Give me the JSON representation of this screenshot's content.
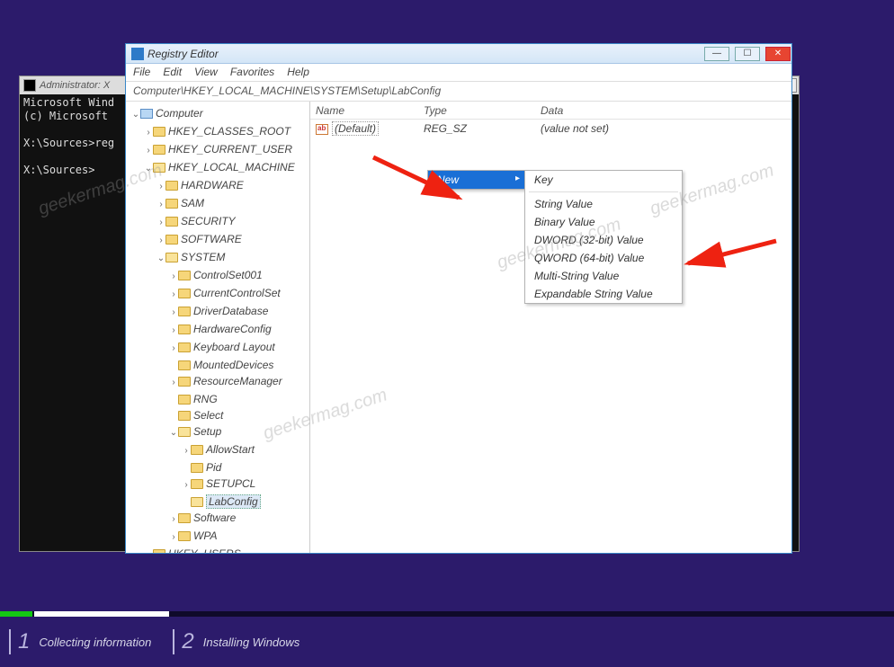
{
  "cmd": {
    "title": "Administrator: X",
    "lines": [
      "Microsoft Wind",
      "(c) Microsoft ",
      "",
      "X:\\Sources>reg",
      "",
      "X:\\Sources>"
    ]
  },
  "regedit": {
    "title": "Registry Editor",
    "menubar": [
      "File",
      "Edit",
      "View",
      "Favorites",
      "Help"
    ],
    "address": "Computer\\HKEY_LOCAL_MACHINE\\SYSTEM\\Setup\\LabConfig",
    "cols": {
      "name": "Name",
      "type": "Type",
      "data": "Data"
    },
    "rows": [
      {
        "name": "(Default)",
        "type": "REG_SZ",
        "data": "(value not set)"
      }
    ],
    "tree": {
      "root": "Computer",
      "hives": {
        "hkcr": "HKEY_CLASSES_ROOT",
        "hkcu": "HKEY_CURRENT_USER",
        "hklm": "HKEY_LOCAL_MACHINE",
        "hku": "HKEY_USERS"
      },
      "hklm_children": [
        "HARDWARE",
        "SAM",
        "SECURITY",
        "SOFTWARE",
        "SYSTEM"
      ],
      "system_children": [
        "ControlSet001",
        "CurrentControlSet",
        "DriverDatabase",
        "HardwareConfig",
        "Keyboard Layout",
        "MountedDevices",
        "ResourceManager",
        "RNG",
        "Select",
        "Setup",
        "Software",
        "WPA"
      ],
      "setup_children": [
        "AllowStart",
        "Pid",
        "SETUPCL",
        "LabConfig"
      ],
      "selected": "LabConfig"
    },
    "context1": {
      "new": "New"
    },
    "context2": {
      "key": "Key",
      "string": "String Value",
      "binary": "Binary Value",
      "dword": "DWORD (32-bit) Value",
      "qword": "QWORD (64-bit) Value",
      "multi": "Multi-String Value",
      "expand": "Expandable String Value"
    }
  },
  "footer": {
    "step1": "Collecting information",
    "step2": "Installing Windows"
  },
  "watermark": "geekermag.com"
}
